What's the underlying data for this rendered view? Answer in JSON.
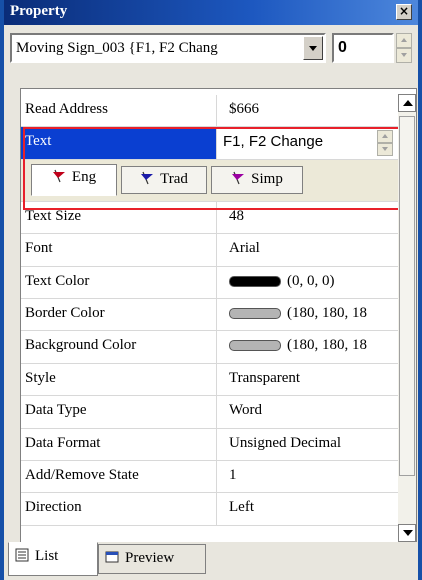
{
  "window": {
    "title": "Property"
  },
  "selector": {
    "value": "Moving Sign_003 {F1, F2  Chang",
    "index": "0"
  },
  "rows": [
    {
      "label": "Read Address",
      "value": "$666"
    },
    {
      "label": "Text",
      "value": "F1, F2  Change"
    },
    {
      "label": "Text Size",
      "value": "48"
    },
    {
      "label": "Font",
      "value": "Arial"
    },
    {
      "label": "Text Color",
      "value": "(0, 0, 0)"
    },
    {
      "label": "Border Color",
      "value": "(180, 180, 18"
    },
    {
      "label": "Background Color",
      "value": "(180, 180, 18"
    },
    {
      "label": "Style",
      "value": "Transparent"
    },
    {
      "label": "Data Type",
      "value": "Word"
    },
    {
      "label": "Data Format",
      "value": "Unsigned Decimal"
    },
    {
      "label": "Add/Remove State",
      "value": "1"
    },
    {
      "label": "Direction",
      "value": "Left"
    }
  ],
  "language_tabs": [
    {
      "label": "Eng",
      "flag_color": "#c0001a"
    },
    {
      "label": "Trad",
      "flag_color": "#1a1aa8"
    },
    {
      "label": "Simp",
      "flag_color": "#9a00a0"
    }
  ],
  "bottom_tabs": [
    {
      "label": "List"
    },
    {
      "label": "Preview"
    }
  ],
  "colors": {
    "title_bar": "#1d58c0",
    "selection": "#0a3fd1",
    "highlight": "#e8202a"
  }
}
